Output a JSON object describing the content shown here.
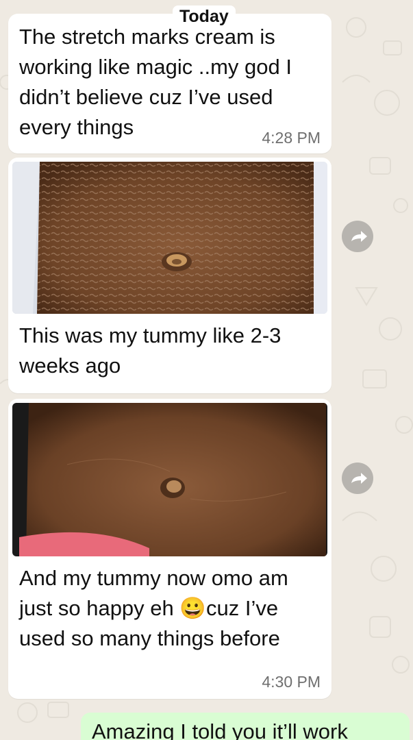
{
  "chat": {
    "date_divider": "Today",
    "messages": [
      {
        "text": "The stretch marks cream is working like magic ..my god I didn’t believe cuz I’ve used every things",
        "time": "4:28 PM"
      },
      {
        "image": "belly-photo-before",
        "caption": "This was my tummy like 2-3 weeks ago",
        "action_icon": "forward-icon"
      },
      {
        "image": "belly-photo-after",
        "caption": "And my tummy now omo am just so happy eh 😀cuz I’ve used so many things before",
        "time": "4:30 PM",
        "action_icon": "forward-icon"
      }
    ],
    "outgoing": {
      "text": "Amazing I told you it’ll work"
    }
  },
  "colors": {
    "wallpaper": "#efeae2",
    "incoming_bubble": "#ffffff",
    "outgoing_bubble": "#d9fdd3",
    "timestamp": "#6f6f6f"
  }
}
